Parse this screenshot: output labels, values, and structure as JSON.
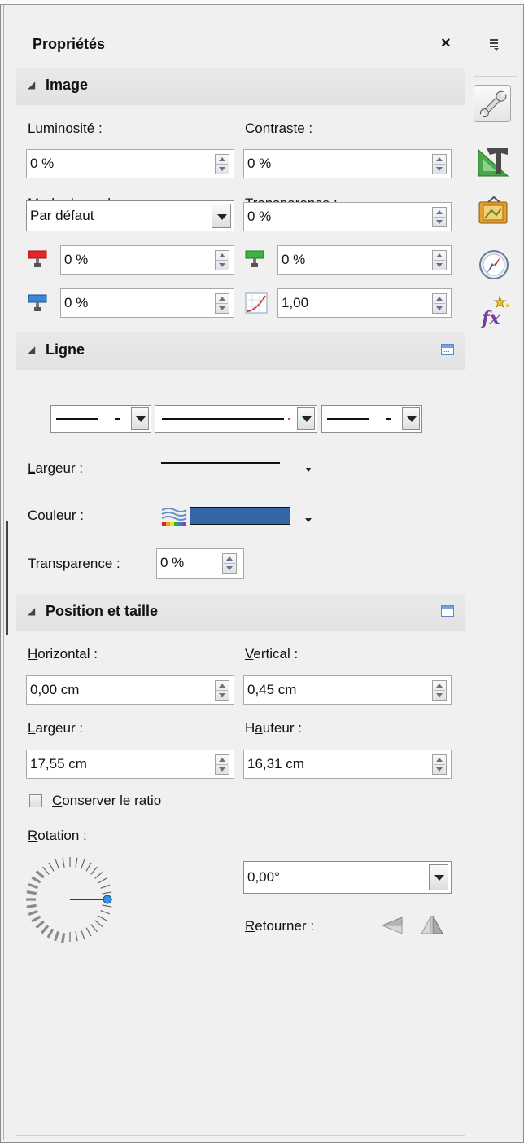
{
  "panel": {
    "title": "Propriétés",
    "close_glyph": "×"
  },
  "image_section": {
    "title": "Image",
    "brightness": {
      "label_u": "L",
      "label_rest": "uminosité :",
      "value": "0 %"
    },
    "contrast": {
      "label_u": "C",
      "label_rest": "ontraste :",
      "value": "0 %"
    },
    "color_mode": {
      "label_pre": "Mode de ",
      "label_u": "c",
      "label_rest": "ouleur :",
      "value": "Par défaut"
    },
    "transparency": {
      "label_u": "T",
      "label_rest": "ransparence :",
      "value": "0 %"
    },
    "red": {
      "value": "0 %",
      "icon": "red-channel-icon"
    },
    "green": {
      "value": "0 %",
      "icon": "green-channel-icon"
    },
    "blue": {
      "value": "0 %",
      "icon": "blue-channel-icon"
    },
    "gamma": {
      "value": "1,00",
      "icon": "gamma-curve-icon"
    }
  },
  "line_section": {
    "title": "Ligne",
    "width": {
      "label_u": "L",
      "label_rest": "argeur :"
    },
    "color": {
      "label_u": "C",
      "label_rest": "ouleur :",
      "swatch": "#3465a4"
    },
    "transparency": {
      "label_u": "T",
      "label_rest": "ransparence :",
      "value": "0 %"
    }
  },
  "position_section": {
    "title": "Position et taille",
    "horizontal": {
      "label_u": "H",
      "label_rest": "orizontal :",
      "value": "0,00 cm"
    },
    "vertical": {
      "label_u": "V",
      "label_rest": "ertical :",
      "value": "0,45 cm"
    },
    "width": {
      "label_u": "L",
      "label_rest": "argeur :",
      "value": "17,55 cm"
    },
    "height": {
      "label_pre": "H",
      "label_u": "a",
      "label_rest": "uteur :",
      "value": "16,31 cm"
    },
    "keep_ratio": {
      "label_u": "C",
      "label_rest": "onserver le ratio",
      "checked": false
    },
    "rotation": {
      "label_u": "R",
      "label_rest": "otation :",
      "value": "0,00°"
    },
    "flip": {
      "label_u": "R",
      "label_rest": "etourner :"
    }
  },
  "sidebar": {
    "menu_icon": "sidebar-menu-icon",
    "items": [
      "properties-wrench-icon",
      "styles-formatting-icon",
      "gallery-icon",
      "navigator-icon",
      "functions-fx-icon"
    ]
  }
}
